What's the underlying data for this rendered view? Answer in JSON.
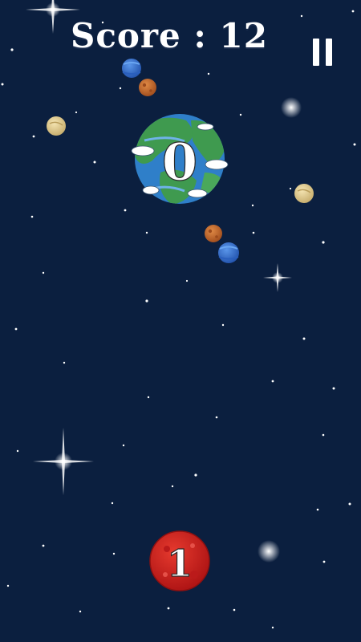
{
  "hud": {
    "score_text": "Score : 12",
    "pause_icon": "pause-icon"
  },
  "planets": {
    "target_number": "0",
    "player_number": "1"
  },
  "colors": {
    "background": "#0b1f3f",
    "earth_ocean": "#2f7fc9",
    "earth_land": "#3f9a4f",
    "mars": "#c86a2f",
    "neptune": "#3d7ad9",
    "venus": "#e8d59a",
    "red_planet": "#d42020"
  }
}
